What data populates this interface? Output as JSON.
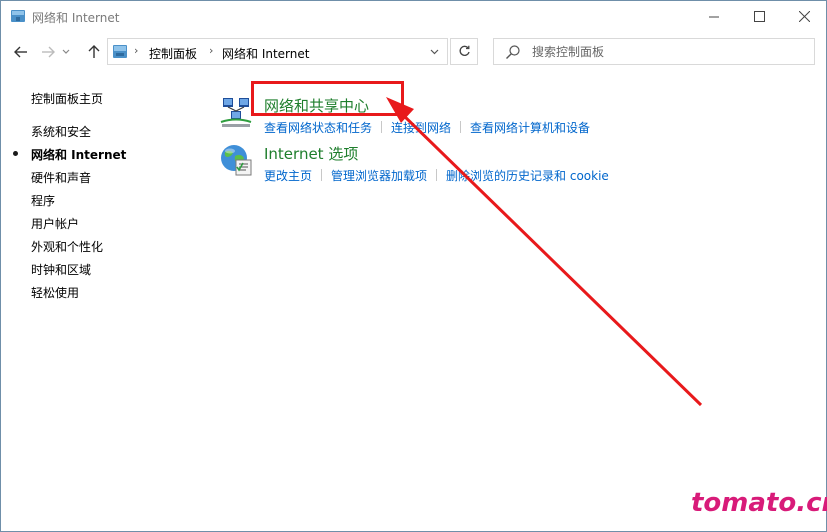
{
  "window": {
    "title": "网络和 Internet",
    "icons": {
      "app": "network-folder-icon",
      "minimize": "minimize-icon",
      "maximize": "maximize-icon",
      "close": "close-icon"
    }
  },
  "navigation": {
    "breadcrumb": [
      "控制面板",
      "网络和 Internet"
    ],
    "icons": {
      "back": "arrow-left-icon",
      "forward": "arrow-right-icon",
      "recent": "chevron-down-icon",
      "up": "arrow-up-icon",
      "refresh": "refresh-icon"
    }
  },
  "search": {
    "placeholder": "搜索控制面板",
    "value": "",
    "icon": "search-icon"
  },
  "sidebar": {
    "home": "控制面板主页",
    "items": [
      {
        "label": "系统和安全",
        "current": false
      },
      {
        "label": "网络和 Internet",
        "current": true
      },
      {
        "label": "硬件和声音",
        "current": false
      },
      {
        "label": "程序",
        "current": false
      },
      {
        "label": "用户帐户",
        "current": false
      },
      {
        "label": "外观和个性化",
        "current": false
      },
      {
        "label": "时钟和区域",
        "current": false
      },
      {
        "label": "轻松使用",
        "current": false
      }
    ]
  },
  "categories": [
    {
      "title": "网络和共享中心",
      "icon": "network-sharing-center-icon",
      "links": [
        "查看网络状态和任务",
        "连接到网络",
        "查看网络计算机和设备"
      ]
    },
    {
      "title": "Internet 选项",
      "icon": "internet-options-globe-icon",
      "links": [
        "更改主页",
        "管理浏览器加载项",
        "删除浏览的历史记录和 cookie"
      ]
    }
  ],
  "annotation": {
    "highlight_color": "#e8191b",
    "watermark": "tomato.cm",
    "watermark_color": "#d81b79"
  },
  "colors": {
    "category_title": "#1e7e2c",
    "task_link": "#0066cc"
  }
}
